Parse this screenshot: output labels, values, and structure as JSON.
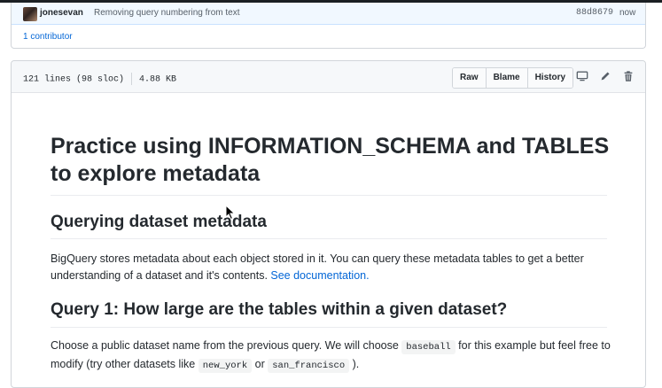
{
  "commit": {
    "author": "jonesevan",
    "message": "Removing query numbering from text",
    "sha": "88d8679",
    "time": "now",
    "contributors": "1 contributor"
  },
  "file_header": {
    "lines": "121 lines (98 sloc)",
    "size": "4.88 KB",
    "buttons": [
      "Raw",
      "Blame",
      "History"
    ],
    "icons": [
      "desktop-icon",
      "pencil-icon",
      "trash-icon"
    ]
  },
  "readme": {
    "title": "Practice using INFORMATION_SCHEMA and TABLES to explore metadata",
    "section1_heading": "Querying dataset metadata",
    "section1_text": "BigQuery stores metadata about each object stored in it. You can query these metadata tables to get a better understanding of a dataset and it's contents. ",
    "section1_link": "See documentation.",
    "section2_heading": "Query 1: How large are the tables within a given dataset?",
    "section2_text_a": "Choose a public dataset name from the previous query. We will choose ",
    "section2_code1": "baseball",
    "section2_text_b": " for this example but feel free to modify (try other datasets like ",
    "section2_code2": "new_york",
    "section2_text_c": " or ",
    "section2_code3": "san_francisco",
    "section2_text_d": " )."
  },
  "colors": {
    "link": "#0366d6",
    "commit_bg": "#f1f8ff",
    "header_bg": "#f6f8fa"
  }
}
